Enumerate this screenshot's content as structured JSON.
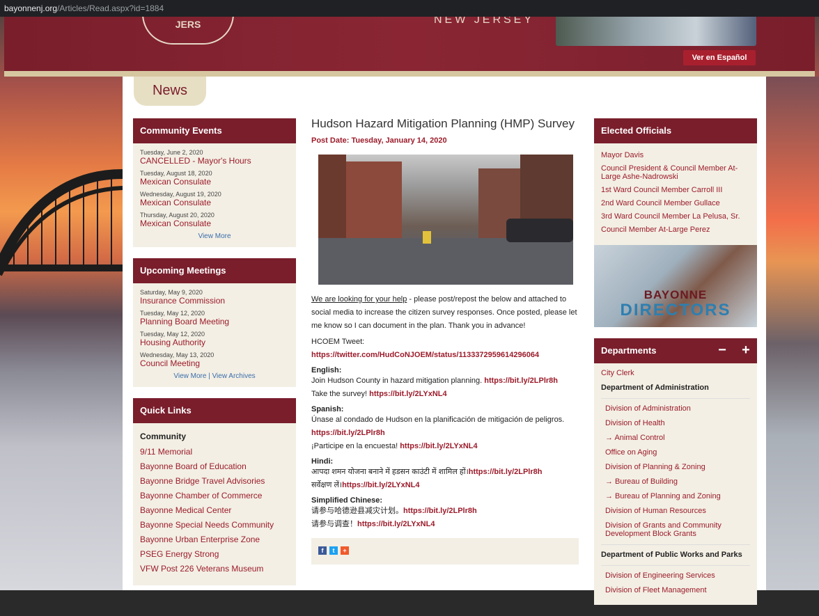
{
  "browser": {
    "host": "bayonnenj.org",
    "path": "/Articles/Read.aspx?id=1884"
  },
  "header": {
    "seal_text": "JERS",
    "state_text": "NEW JERSEY",
    "espanol_button": "Ver en Español"
  },
  "section_tab": "News",
  "community_events": {
    "title": "Community Events",
    "items": [
      {
        "date": "Tuesday, June 2, 2020",
        "title": "CANCELLED - Mayor's Hours"
      },
      {
        "date": "Tuesday, August 18, 2020",
        "title": "Mexican Consulate"
      },
      {
        "date": "Wednesday, August 19, 2020",
        "title": "Mexican Consulate"
      },
      {
        "date": "Thursday, August 20, 2020",
        "title": "Mexican Consulate"
      }
    ],
    "more": "View More"
  },
  "upcoming_meetings": {
    "title": "Upcoming Meetings",
    "items": [
      {
        "date": "Saturday, May 9, 2020",
        "title": "Insurance Commission"
      },
      {
        "date": "Tuesday, May 12, 2020",
        "title": "Planning Board Meeting"
      },
      {
        "date": "Tuesday, May 12, 2020",
        "title": "Housing Authority"
      },
      {
        "date": "Wednesday, May 13, 2020",
        "title": "Council Meeting"
      }
    ],
    "more": "View More | View Archives"
  },
  "quick_links": {
    "title": "Quick Links",
    "heading": "Community",
    "links": [
      "9/11 Memorial",
      "Bayonne Board of Education",
      "Bayonne Bridge Travel Advisories",
      "Bayonne Chamber of Commerce",
      "Bayonne Medical Center",
      "Bayonne Special Needs Community",
      "Bayonne Urban Enterprise Zone",
      "PSEG Energy Strong",
      "VFW Post 226 Veterans Museum"
    ]
  },
  "article": {
    "title": "Hudson Hazard Mitigation Planning (HMP) Survey",
    "post_date": "Post Date: Tuesday, January 14, 2020",
    "intro_link": "We are looking for your help",
    "intro_rest": " - please post/repost the below and attached to social media to increase the citizen survey responses.  Once posted, please let me know so I can document in the plan.  Thank you in advance!",
    "hcoem_label": "HCOEM Tweet:",
    "hcoem_link": "https://twitter.com/HudCoNJOEM/status/1133372959614296064",
    "english_label": "English:",
    "english_line1": "Join Hudson County in hazard mitigation planning. ",
    "english_link1": "https://bit.ly/2LPlr8h",
    "english_line2": "Take the survey! ",
    "english_link2": "https://bit.ly/2LYxNL4",
    "spanish_label": "Spanish:",
    "spanish_line1": "Únase al condado de Hudson en la planificación de mitigación de peligros. ",
    "spanish_link1": "https://bit.ly/2LPlr8h",
    "spanish_line2": "¡Participe en la encuesta! ",
    "spanish_link2": "https://bit.ly/2LYxNL4",
    "hindi_label": "Hindi:",
    "hindi_line1": "आपदा शमन योजना बनाने में हडसन काउंटी में शामिल हों।",
    "hindi_link1": "https://bit.ly/2LPlr8h",
    "hindi_line2": "सर्वेक्षण लें।",
    "hindi_link2": "https://bit.ly/2LYxNL4",
    "chinese_label": "Simplified Chinese:",
    "chinese_line1": "请参与哈德逊县减灾计划。",
    "chinese_link1": "https://bit.ly/2LPlr8h",
    "chinese_line2": "请参与调查！",
    "chinese_link2": "https://bit.ly/2LYxNL4"
  },
  "share": {
    "facebook": "f",
    "twitter": "t",
    "plus": "+"
  },
  "elected_officials": {
    "title": "Elected Officials",
    "items": [
      "Mayor Davis",
      "Council President & Council Member At-Large Ashe-Nadrowski",
      "1st Ward Council Member Carroll III",
      "2nd Ward Council Member Gullace",
      "3rd Ward Council Member La Pelusa, Sr.",
      "Council Member At-Large Perez"
    ]
  },
  "directors_banner": {
    "line1": "BAYONNE",
    "line2": "DIRECTORS"
  },
  "departments": {
    "title": "Departments",
    "collapse": "−",
    "expand": "+",
    "items": [
      {
        "label": "City Clerk",
        "style": "red"
      },
      {
        "label": "Department of Administration",
        "style": "dark"
      },
      {
        "label": "Division of Administration",
        "style": "red indent"
      },
      {
        "label": "Division of Health",
        "style": "red indent"
      },
      {
        "label": "→  Animal Control",
        "style": "red indent"
      },
      {
        "label": "Office on Aging",
        "style": "red indent"
      },
      {
        "label": "Division of Planning & Zoning",
        "style": "red indent"
      },
      {
        "label": "→  Bureau of Building",
        "style": "red indent"
      },
      {
        "label": "→  Bureau of Planning and Zoning",
        "style": "red indent"
      },
      {
        "label": "Division of Human Resources",
        "style": "red indent"
      },
      {
        "label": "Division of Grants and Community Development Block Grants",
        "style": "red indent"
      },
      {
        "label": "Department of Public Works and Parks",
        "style": "dark"
      },
      {
        "label": "Division of Engineering Services",
        "style": "red indent"
      },
      {
        "label": "Division of Fleet Management",
        "style": "red indent"
      }
    ]
  }
}
